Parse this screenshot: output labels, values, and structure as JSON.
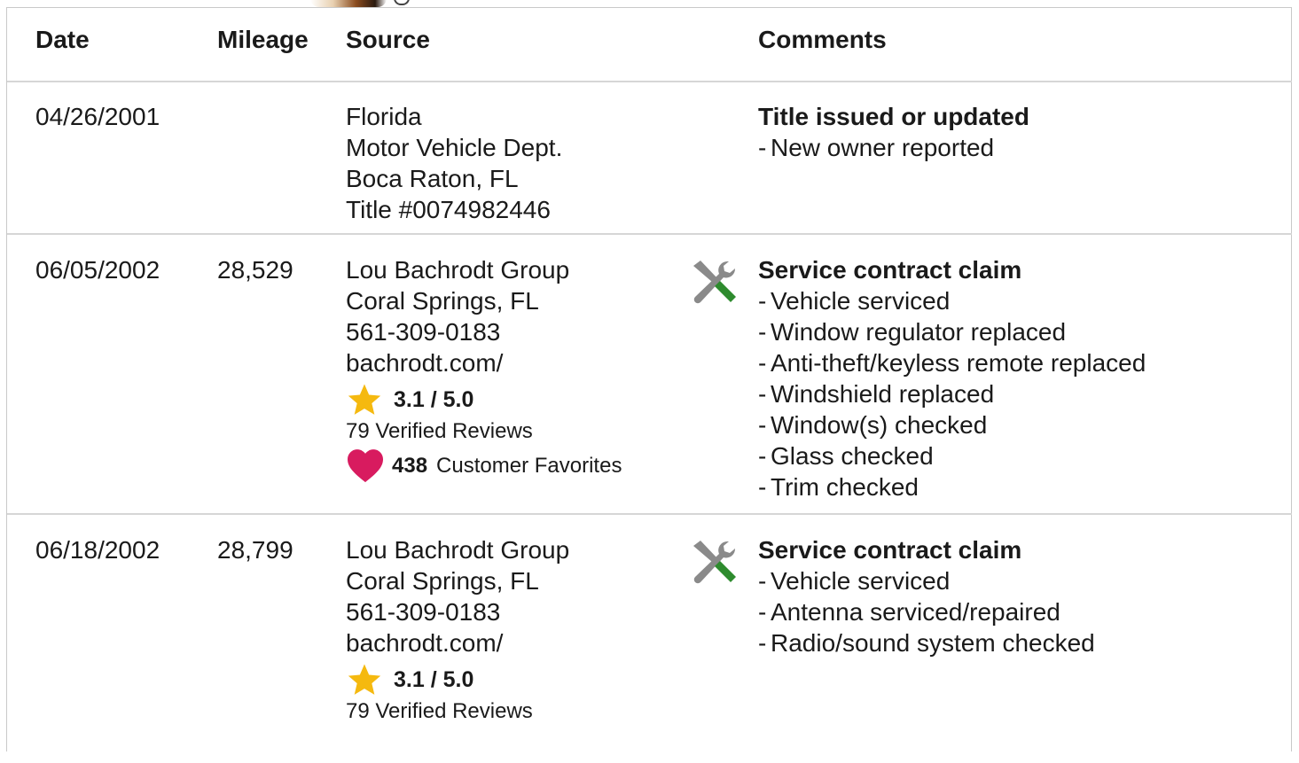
{
  "header": {
    "date": "Date",
    "mileage": "Mileage",
    "source": "Source",
    "comments": "Comments"
  },
  "rows": [
    {
      "date": "04/26/2001",
      "mileage": "",
      "source": [
        "Florida",
        "Motor Vehicle Dept.",
        "Boca Raton, FL",
        "Title #0074982446"
      ],
      "icon": "",
      "comment_title": "Title issued or updated",
      "comment_items": [
        "New owner reported"
      ]
    },
    {
      "date": "06/05/2002",
      "mileage": "28,529",
      "source": [
        "Lou Bachrodt Group",
        "Coral Springs, FL",
        "561-309-0183",
        "bachrodt.com/"
      ],
      "rating": "3.1 / 5.0",
      "reviews": "79 Verified Reviews",
      "favorites_count": "438",
      "favorites_label": "Customer Favorites",
      "icon": "service-tools-icon",
      "comment_title": "Service contract claim",
      "comment_items": [
        "Vehicle serviced",
        "Window regulator replaced",
        "Anti-theft/keyless remote replaced",
        "Windshield replaced",
        "Window(s) checked",
        "Glass checked",
        "Trim checked"
      ]
    },
    {
      "date": "06/18/2002",
      "mileage": "28,799",
      "source": [
        "Lou Bachrodt Group",
        "Coral Springs, FL",
        "561-309-0183",
        "bachrodt.com/"
      ],
      "rating": "3.1 / 5.0",
      "reviews": "79 Verified Reviews",
      "icon": "service-tools-icon",
      "comment_title": "Service contract claim",
      "comment_items": [
        "Vehicle serviced",
        "Antenna serviced/repaired",
        "Radio/sound system checked"
      ]
    }
  ],
  "colors": {
    "star": "#f5b90f",
    "heart": "#d81b5f",
    "wrench": "#8a8a8a",
    "screwdriver": "#2e8b2e",
    "border": "#d6d6d6"
  }
}
